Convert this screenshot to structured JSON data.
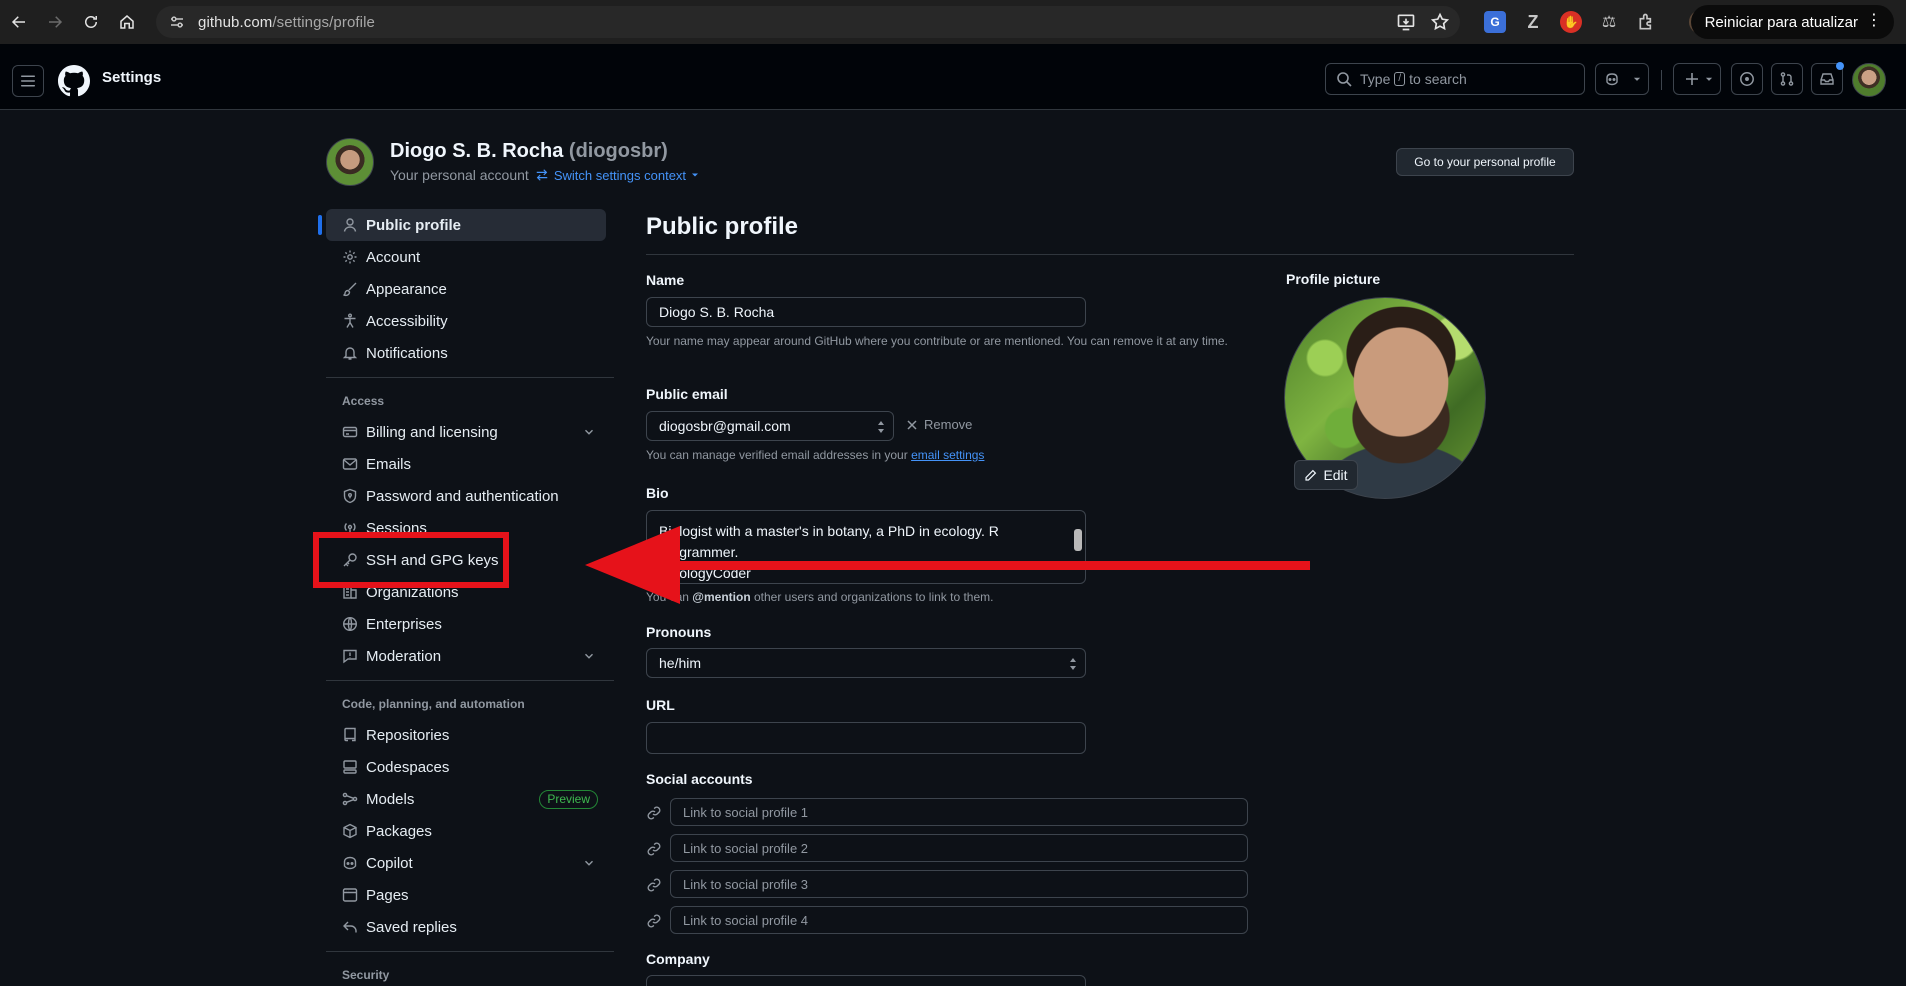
{
  "browser": {
    "url_host": "github.com",
    "url_path": "/settings/profile",
    "update_button_label": "Reiniciar para atualizar"
  },
  "header": {
    "context_title": "Settings",
    "search_placeholder_pre": "Type",
    "search_key": "/",
    "search_placeholder_post": "to search"
  },
  "account": {
    "display_name": "Diogo S. B. Rocha",
    "login": "(diogosbr)",
    "subtitle": "Your personal account",
    "switch_label": "Switch settings context",
    "goto_profile_label": "Go to your personal profile"
  },
  "sidebar": {
    "top_items": [
      {
        "label": "Public profile",
        "icon": "person-icon",
        "active": true
      },
      {
        "label": "Account",
        "icon": "gear-icon"
      },
      {
        "label": "Appearance",
        "icon": "paintbrush-icon"
      },
      {
        "label": "Accessibility",
        "icon": "accessibility-icon"
      },
      {
        "label": "Notifications",
        "icon": "bell-icon"
      }
    ],
    "access_heading": "Access",
    "access_items": [
      {
        "label": "Billing and licensing",
        "icon": "credit-card-icon",
        "expandable": true
      },
      {
        "label": "Emails",
        "icon": "mail-icon"
      },
      {
        "label": "Password and authentication",
        "icon": "shield-lock-icon"
      },
      {
        "label": "Sessions",
        "icon": "broadcast-icon"
      },
      {
        "label": "SSH and GPG keys",
        "icon": "key-icon"
      },
      {
        "label": "Organizations",
        "icon": "organization-icon"
      },
      {
        "label": "Enterprises",
        "icon": "globe-icon"
      },
      {
        "label": "Moderation",
        "icon": "report-icon",
        "expandable": true
      }
    ],
    "code_heading": "Code, planning, and automation",
    "code_items": [
      {
        "label": "Repositories",
        "icon": "repo-icon"
      },
      {
        "label": "Codespaces",
        "icon": "codespaces-icon"
      },
      {
        "label": "Models",
        "icon": "ai-model-icon",
        "badge": "Preview"
      },
      {
        "label": "Packages",
        "icon": "package-icon"
      },
      {
        "label": "Copilot",
        "icon": "copilot-icon",
        "expandable": true
      },
      {
        "label": "Pages",
        "icon": "browser-icon"
      },
      {
        "label": "Saved replies",
        "icon": "reply-icon"
      }
    ],
    "security_heading": "Security"
  },
  "main": {
    "title": "Public profile",
    "name_label": "Name",
    "name_value": "Diogo S. B. Rocha",
    "name_note": "Your name may appear around GitHub where you contribute or are mentioned. You can remove it at any time.",
    "email_label": "Public email",
    "email_value": "diogosbr@gmail.com",
    "remove_label": "Remove",
    "email_note_pre": "You can manage verified email addresses in your",
    "email_note_link": "email settings",
    "bio_label": "Bio",
    "bio_line1": "Biologist with a master's in botany, a PhD in ecology. R",
    "bio_line2": "programmer.",
    "bio_line3": "#BiologyCoder",
    "bio_note_pre": "You can",
    "bio_note_mention": "@mention",
    "bio_note_post": "other users and organizations to link to them.",
    "pronouns_label": "Pronouns",
    "pronouns_value": "he/him",
    "url_label": "URL",
    "url_value": "",
    "social_label": "Social accounts",
    "social_placeholders": [
      "Link to social profile 1",
      "Link to social profile 2",
      "Link to social profile 3",
      "Link to social profile 4"
    ],
    "company_label": "Company",
    "profile_picture_label": "Profile picture",
    "edit_label": "Edit"
  },
  "colors": {
    "background": "#0d1117",
    "header_bg": "#010409",
    "accent_blue": "#4493f8",
    "annotation_red": "#e6121a",
    "preview_badge_green": "#3fb950"
  }
}
